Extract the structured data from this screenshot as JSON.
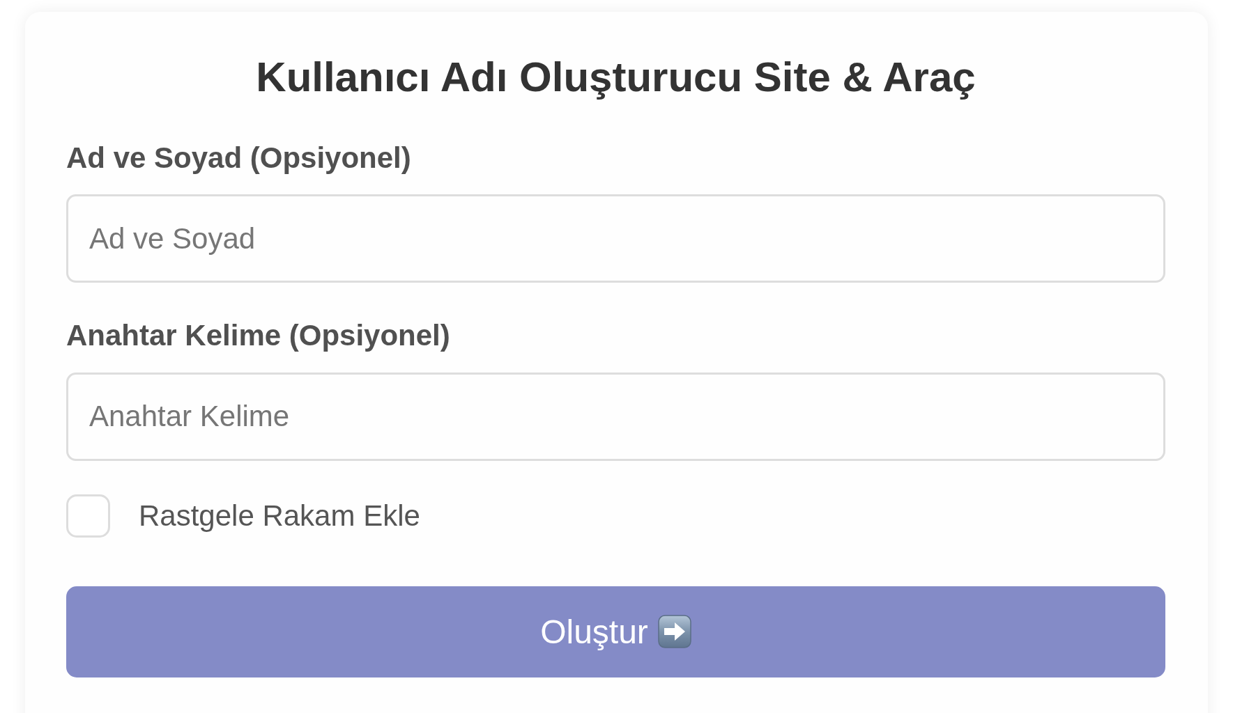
{
  "title": "Kullanıcı Adı Oluşturucu Site & Araç",
  "fields": [
    {
      "label": "Ad ve Soyad (Opsiyonel)",
      "placeholder": "Ad ve Soyad"
    },
    {
      "label": "Anahtar Kelime (Opsiyonel)",
      "placeholder": "Anahtar Kelime"
    }
  ],
  "checkbox": {
    "label": "Rastgele Rakam Ekle",
    "checked": false
  },
  "submit_button": {
    "label": "Oluştur"
  }
}
